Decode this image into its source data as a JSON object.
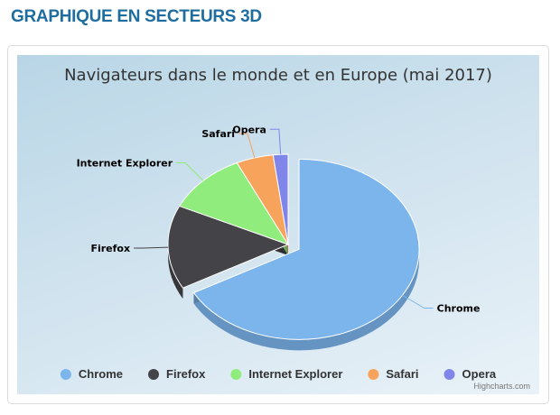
{
  "page": {
    "heading": "GRAPHIQUE EN SECTEURS 3D",
    "heading_color": "#1f6d9e"
  },
  "chart_data": {
    "type": "pie",
    "is_3d": true,
    "title": "Navigateurs dans le monde et en Europe (mai 2017)",
    "legend_position": "bottom",
    "categories": [
      "Chrome",
      "Firefox",
      "Internet Explorer",
      "Safari",
      "Opera"
    ],
    "values": [
      67,
      15,
      11,
      5,
      2
    ],
    "colors": [
      "#7cb5ec",
      "#434348",
      "#90ed7d",
      "#f7a35c",
      "#8085e9"
    ],
    "sliced": "Chrome",
    "credit": "Highcharts.com"
  }
}
